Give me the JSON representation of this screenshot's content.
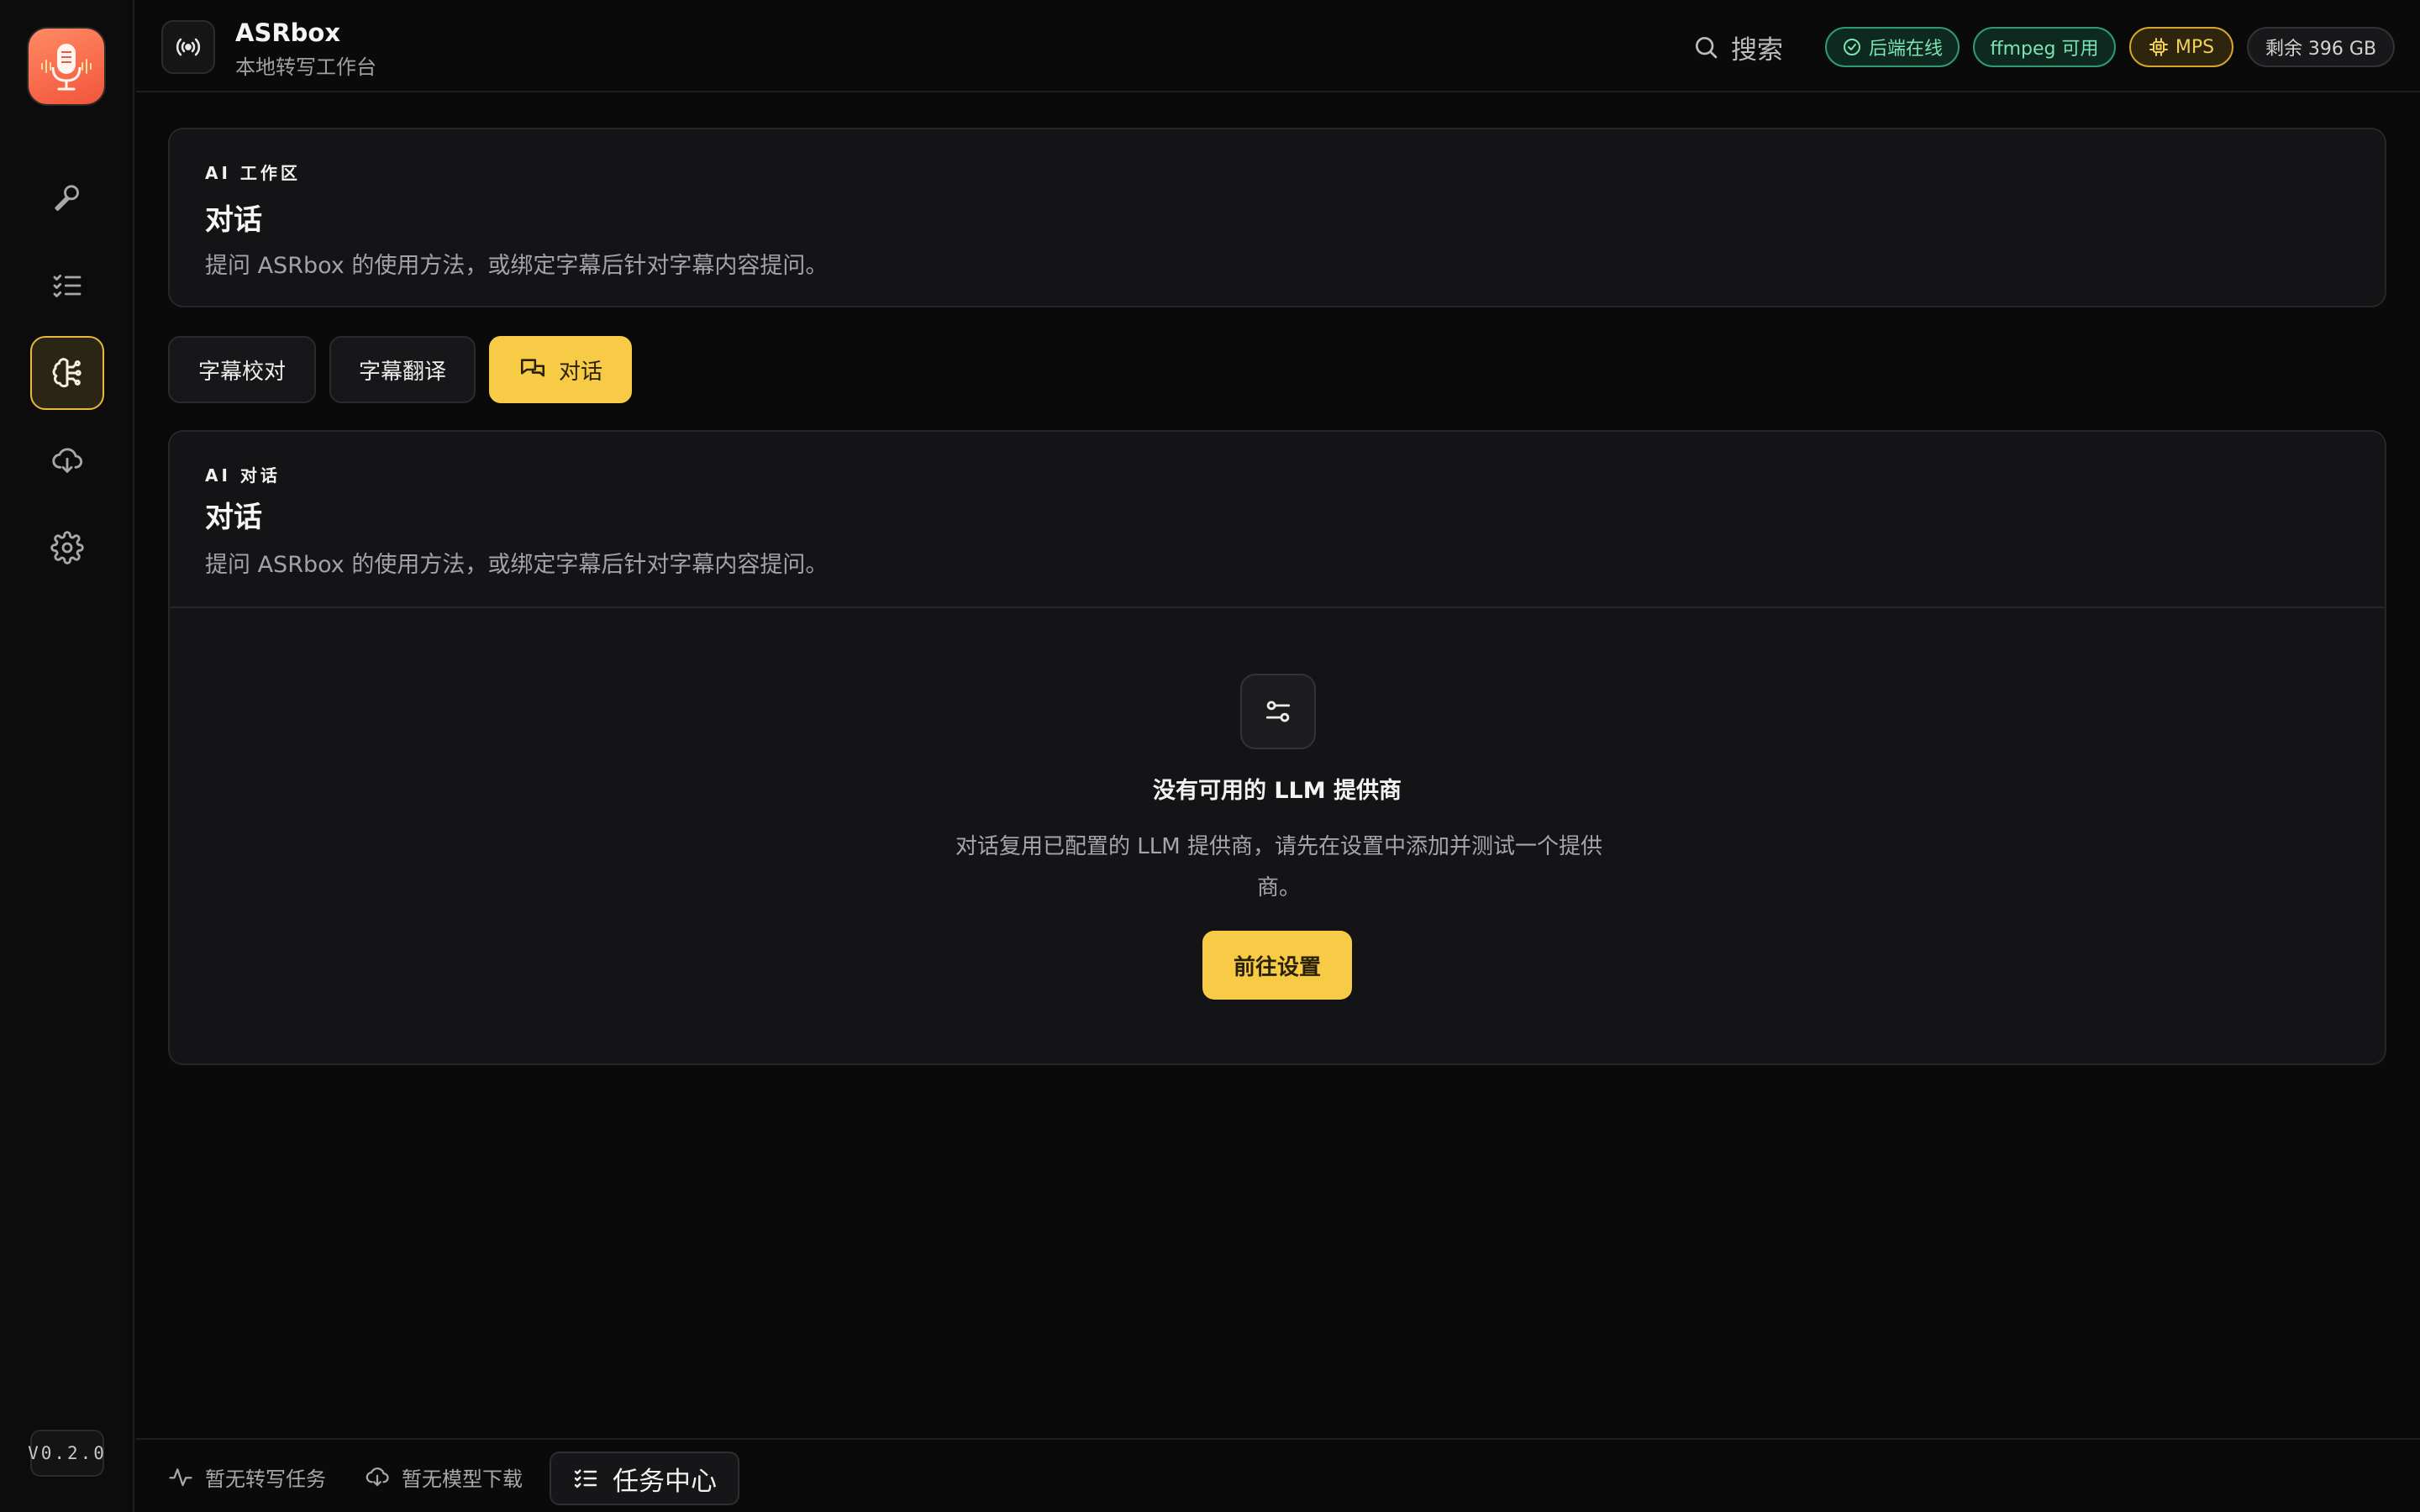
{
  "app": {
    "title": "ASRbox",
    "subtitle": "本地转写工作台",
    "version": "V0.2.0"
  },
  "header": {
    "search_label": "搜索",
    "badges": {
      "backend": "后端在线",
      "ffmpeg": "ffmpeg 可用",
      "device": "MPS",
      "storage": "剩余 396 GB"
    }
  },
  "sidebar": {
    "items": [
      {
        "id": "transcribe",
        "icon": "microphone-icon",
        "active": false
      },
      {
        "id": "tasks",
        "icon": "checklist-icon",
        "active": false
      },
      {
        "id": "ai",
        "icon": "brain-icon",
        "active": true
      },
      {
        "id": "downloads",
        "icon": "cloud-download-icon",
        "active": false
      },
      {
        "id": "settings",
        "icon": "gear-icon",
        "active": false
      }
    ]
  },
  "workspace": {
    "eyebrow": "AI 工作区",
    "title": "对话",
    "description": "提问 ASRbox 的使用方法，或绑定字幕后针对字幕内容提问。"
  },
  "tabs": [
    {
      "label": "字幕校对",
      "active": false
    },
    {
      "label": "字幕翻译",
      "active": false
    },
    {
      "label": "对话",
      "active": true,
      "icon": "chat-icon"
    }
  ],
  "chat_panel": {
    "eyebrow": "AI 对话",
    "title": "对话",
    "description": "提问 ASRbox 的使用方法，或绑定字幕后针对字幕内容提问。",
    "empty": {
      "icon": "sliders-icon",
      "title": "没有可用的 LLM 提供商",
      "description": "对话复用已配置的 LLM 提供商，请先在设置中添加并测试一个提供商。",
      "button": "前往设置"
    }
  },
  "footer": {
    "transcribe_status": "暂无转写任务",
    "download_status": "暂无模型下载",
    "task_center": "任务中心"
  },
  "colors": {
    "accent": "#f8cb46",
    "background": "#0a0a0b",
    "card": "#141416",
    "success": "#7be3b4",
    "logo": "#f2553a"
  }
}
